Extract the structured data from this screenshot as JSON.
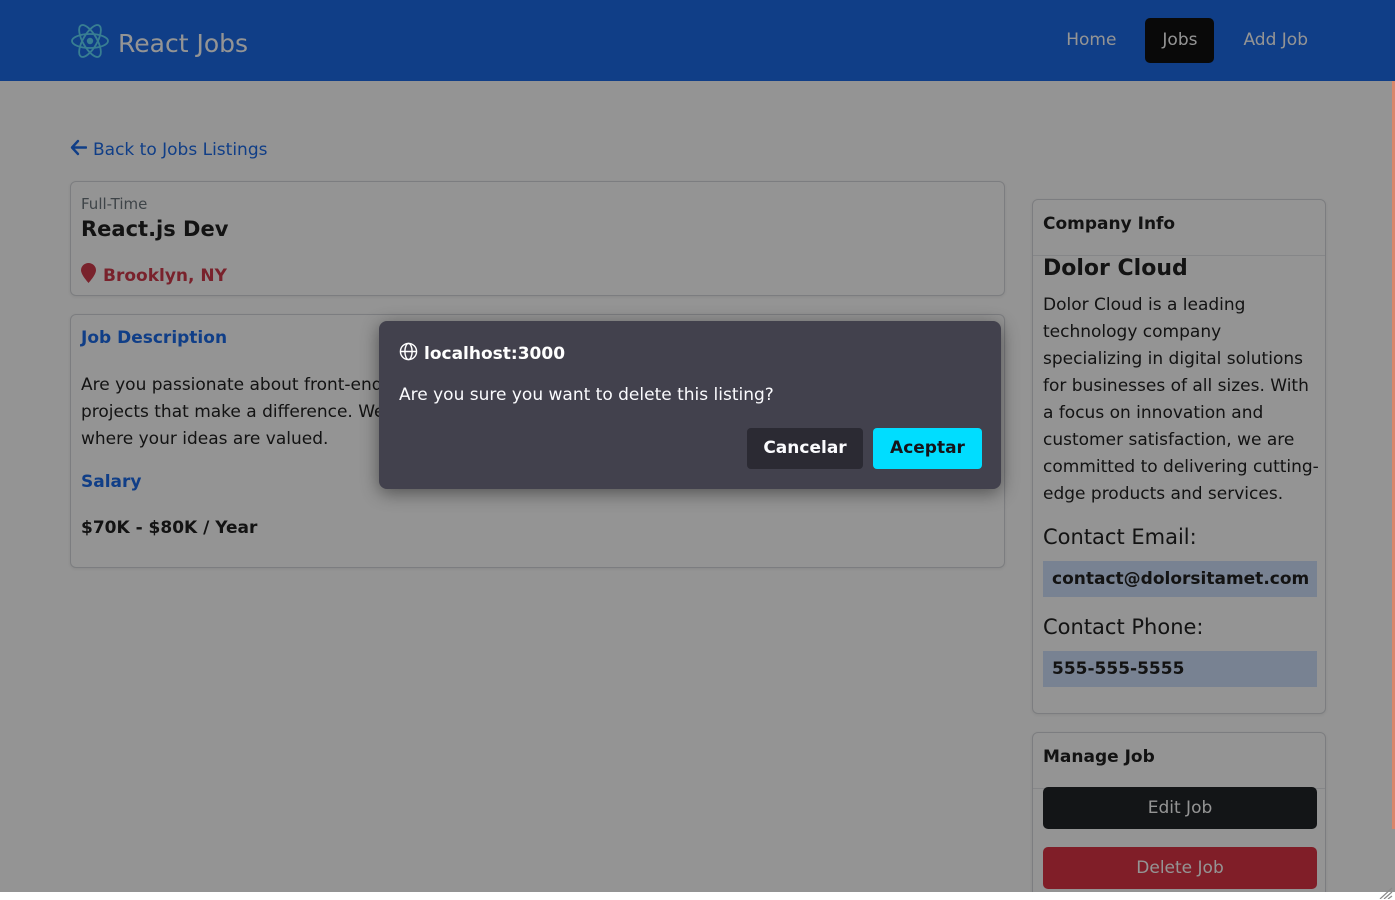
{
  "navbar": {
    "brand": "React Jobs",
    "links": [
      {
        "label": "Home"
      },
      {
        "label": "Jobs"
      },
      {
        "label": "Add Job"
      }
    ],
    "active_link": "Jobs",
    "colors": {
      "background": "#1d6ce8",
      "active": "#111111"
    }
  },
  "back_link": "Back to Jobs Listings",
  "job": {
    "type": "Full-Time",
    "title": "React.js Dev",
    "location": "Brooklyn, NY",
    "description_heading": "Job Description",
    "description_visible_lines": [
      "Are you passionate about front-end d",
      "projects that make a difference. We c",
      "where your ideas are valued."
    ],
    "salary_heading": "Salary",
    "salary": "$70K - $80K / Year"
  },
  "company": {
    "heading": "Company Info",
    "name": "Dolor Cloud",
    "description": "Dolor Cloud is a leading technology company specializing in digital solutions for businesses of all sizes. With a focus on innovation and customer satisfaction, we are committed to delivering cutting-edge products and services.",
    "email_label": "Contact Email:",
    "email": "contact@dolorsitamet.com",
    "phone_label": "Contact Phone:",
    "phone": "555-555-5555"
  },
  "manage": {
    "heading": "Manage Job",
    "edit_label": "Edit Job",
    "delete_label": "Delete Job"
  },
  "dialog": {
    "origin": "localhost:3000",
    "message": "Are you sure you want to delete this listing?",
    "cancel_label": "Cancelar",
    "ok_label": "Aceptar",
    "colors": {
      "background": "#42414d",
      "ok": "#00ddff"
    }
  },
  "icons": {
    "brand": "react-atom-icon",
    "back": "arrow-left-icon",
    "location": "map-marker-icon",
    "dialog": "globe-icon"
  }
}
